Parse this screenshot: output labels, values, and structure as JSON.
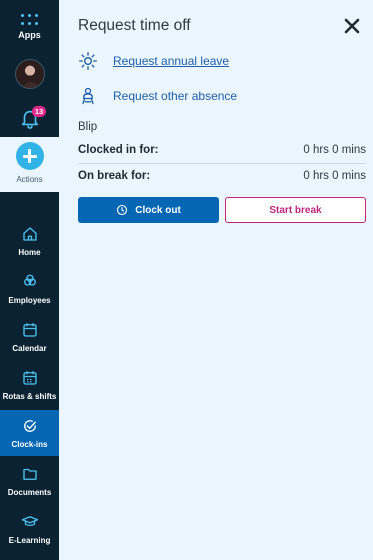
{
  "sidebar": {
    "apps_label": "Apps",
    "notifications_count": "13",
    "actions_label": "Actions",
    "items": [
      {
        "label": "Home",
        "icon": "home-icon"
      },
      {
        "label": "Employees",
        "icon": "employees-icon"
      },
      {
        "label": "Calendar",
        "icon": "calendar-icon"
      },
      {
        "label": "Rotas & shifts",
        "icon": "rota-icon"
      },
      {
        "label": "Clock-ins",
        "icon": "clock-in-icon",
        "active": true
      },
      {
        "label": "Documents",
        "icon": "folder-icon"
      },
      {
        "label": "E-Learning",
        "icon": "graduation-cap-icon"
      }
    ]
  },
  "panel": {
    "title": "Request time off",
    "links": {
      "annual_leave": "Request annual leave",
      "other_absence": "Request other absence"
    },
    "site_name": "Blip",
    "clocked_in_label": "Clocked in for:",
    "clocked_in_value": "0 hrs 0 mins",
    "on_break_label": "On break for:",
    "on_break_value": "0 hrs 0 mins",
    "clock_out_label": "Clock out",
    "start_break_label": "Start break"
  },
  "colors": {
    "sidebar_bg": "#0b2233",
    "panel_bg": "#eaf5fd",
    "primary": "#0567b4",
    "accent_pink": "#c0267d",
    "badge": "#e0288b",
    "action_blue": "#31b3e8"
  }
}
